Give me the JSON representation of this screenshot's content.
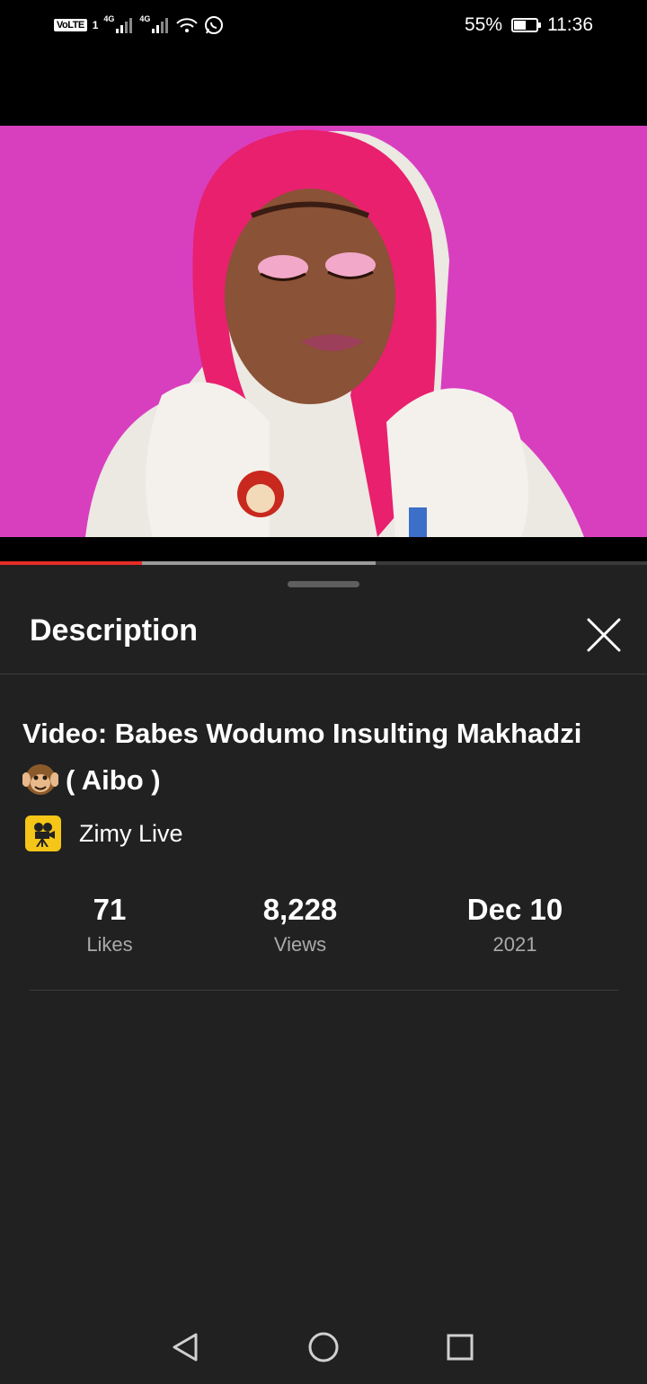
{
  "status_bar": {
    "volte": "VoLTE",
    "sim_slot": "1",
    "network_1": "4G",
    "network_2": "4G",
    "battery_percent": "55%",
    "battery_level": 0.55,
    "time": "11:36",
    "icons": [
      "signal-icon",
      "signal-icon",
      "wifi-icon",
      "whatsapp-icon",
      "battery-icon"
    ]
  },
  "player": {
    "progress_played": 0.22,
    "progress_buffered": 0.58,
    "colors": {
      "played": "#e52d27",
      "buffer": "#9a9a9a"
    }
  },
  "sheet": {
    "title": "Description",
    "close_icon": "close-icon"
  },
  "video": {
    "title": "Video: Babes Wodumo Insulting Makhadzi",
    "title_line2": "( Aibo )",
    "emoji_icon": "hear-no-evil-monkey-icon",
    "channel_name": "Zimy Live",
    "channel_icon": "camera-reel-icon"
  },
  "stats": [
    {
      "value": "71",
      "label": "Likes"
    },
    {
      "value": "8,228",
      "label": "Views"
    },
    {
      "value": "Dec 10",
      "label": "2021"
    }
  ],
  "navbar": {
    "icons": [
      "back-icon",
      "home-icon",
      "recents-icon"
    ]
  }
}
